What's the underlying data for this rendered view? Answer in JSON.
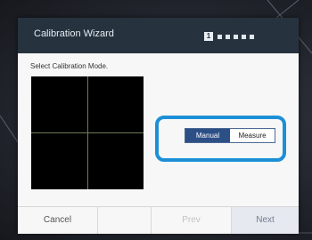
{
  "dialog": {
    "title": "Calibration Wizard",
    "step_current": "1",
    "step_count": 6
  },
  "content": {
    "prompt": "Select Calibration Mode."
  },
  "mode_toggle": {
    "manual_label": "Manual",
    "measure_label": "Measure",
    "selected": "Manual"
  },
  "footer": {
    "cancel_label": "Cancel",
    "prev_label": "Prev",
    "next_label": "Next"
  },
  "colors": {
    "titlebar": "#26333f",
    "accent_selected": "#2c4f86",
    "highlight_ring": "#1d8fd6"
  }
}
